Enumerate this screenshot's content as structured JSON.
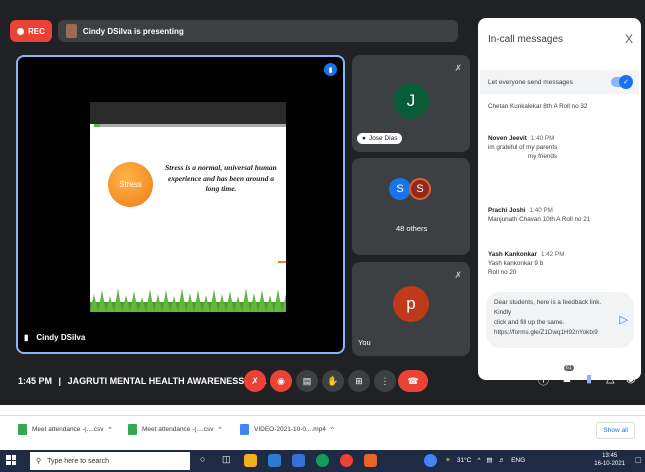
{
  "meeting": {
    "rec_label": "REC",
    "presenting_text": "Cindy DSilva is presenting",
    "slide": {
      "ball_label": "Stress",
      "text": "Stress is a normal, universal human experience and has been around a long time."
    },
    "presenter_name": "Cindy DSilva",
    "tiles": {
      "jose_avatar_letter": "J",
      "jose_name": "Jose Dias",
      "others_letters": [
        "S",
        "S"
      ],
      "others_count": "48 others",
      "you_avatar_letter": "p",
      "you_label": "You"
    },
    "time": "1:45 PM",
    "separator": "|",
    "meeting_title": "JAGRUTI MENTAL HEALTH AWARENESS FO...",
    "participants_badge": "61"
  },
  "chat": {
    "title": "In-call messages",
    "close": "X",
    "setting_label": "Let everyone send messages",
    "messages": [
      {
        "sender": "",
        "time": "",
        "lines": [
          "Chetan Kunkalekar 8th A Roll no 32"
        ]
      },
      {
        "sender": "Noven Jeevit",
        "time": "1:40 PM",
        "lines": [
          "im grateful of my parents",
          "my friends"
        ]
      },
      {
        "sender": "Prachi Joshi",
        "time": "1:40 PM",
        "lines": [
          "Manjunath Chavan 10th A Roll no 21"
        ]
      },
      {
        "sender": "Yash Kankonkar",
        "time": "1:42 PM",
        "lines": [
          "Yash kankonkar 9 b",
          "Roll no 20"
        ]
      }
    ],
    "compose_lines": [
      "Dear students, here is a feedback link. Kindly",
      "click and fill up the same.",
      "https://forms.gle/Z1Dwq1H92nYoktx9"
    ]
  },
  "downloads": {
    "items": [
      "Meet attendance -(....csv",
      "Meet attendance -(....csv",
      "VIDEO-2021-10-0....mp4"
    ],
    "chevron": "^",
    "show_all": "Show all"
  },
  "taskbar": {
    "search_placeholder": "Type here to search",
    "temperature": "31°C",
    "lang": "ENG",
    "clock_time": "13:45",
    "clock_date": "16-10-2021"
  },
  "colors": {
    "accent": "#1a73e8",
    "danger": "#ea4335",
    "meet_bg": "#202124",
    "tile_bg": "#3c4043"
  }
}
